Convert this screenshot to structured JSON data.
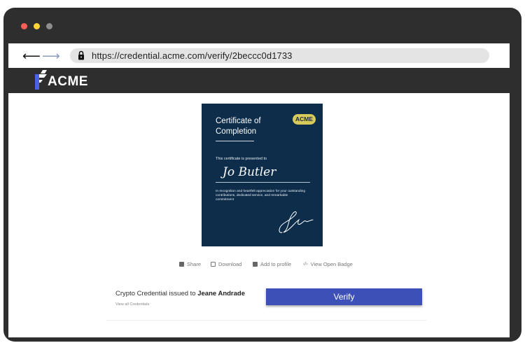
{
  "browser": {
    "url": "https://credential.acme.com/verify/2beccc0d1733",
    "back_icon": "back-arrow-icon",
    "forward_icon": "forward-arrow-icon",
    "lock_icon": "lock-icon",
    "window_dots": [
      "#ff5f57",
      "#ffd43b",
      "#8e8e8e"
    ]
  },
  "site": {
    "brand": "ACME",
    "logo_icon": "acme-logo-icon",
    "logo_accent": "#4a63e0"
  },
  "certificate": {
    "title_line1": "Certificate of",
    "title_line2": "Completion",
    "badge": "ACME",
    "presented_text": "This certificate is presented to",
    "recipient": "Jo Butler",
    "recognition_text": "In recognition and heartfelt appreciation for your outstanding contributions, dedicated service, and remarkable commitment",
    "background": "#0d2d4a",
    "badge_color": "#d7c95a"
  },
  "actions": [
    {
      "label": "Share",
      "icon": "share-icon"
    },
    {
      "label": "Download",
      "icon": "download-icon"
    },
    {
      "label": "Add to profile",
      "icon": "add-to-profile-icon"
    },
    {
      "label": "View Open Badge",
      "icon": "code-icon"
    }
  ],
  "credential": {
    "issued_prefix": "Crypto Credential issued to ",
    "issued_name": "Jeane Andrade",
    "view_all": "View all Credentials",
    "verify_label": "Verify",
    "verify_color": "#3d50b8"
  }
}
